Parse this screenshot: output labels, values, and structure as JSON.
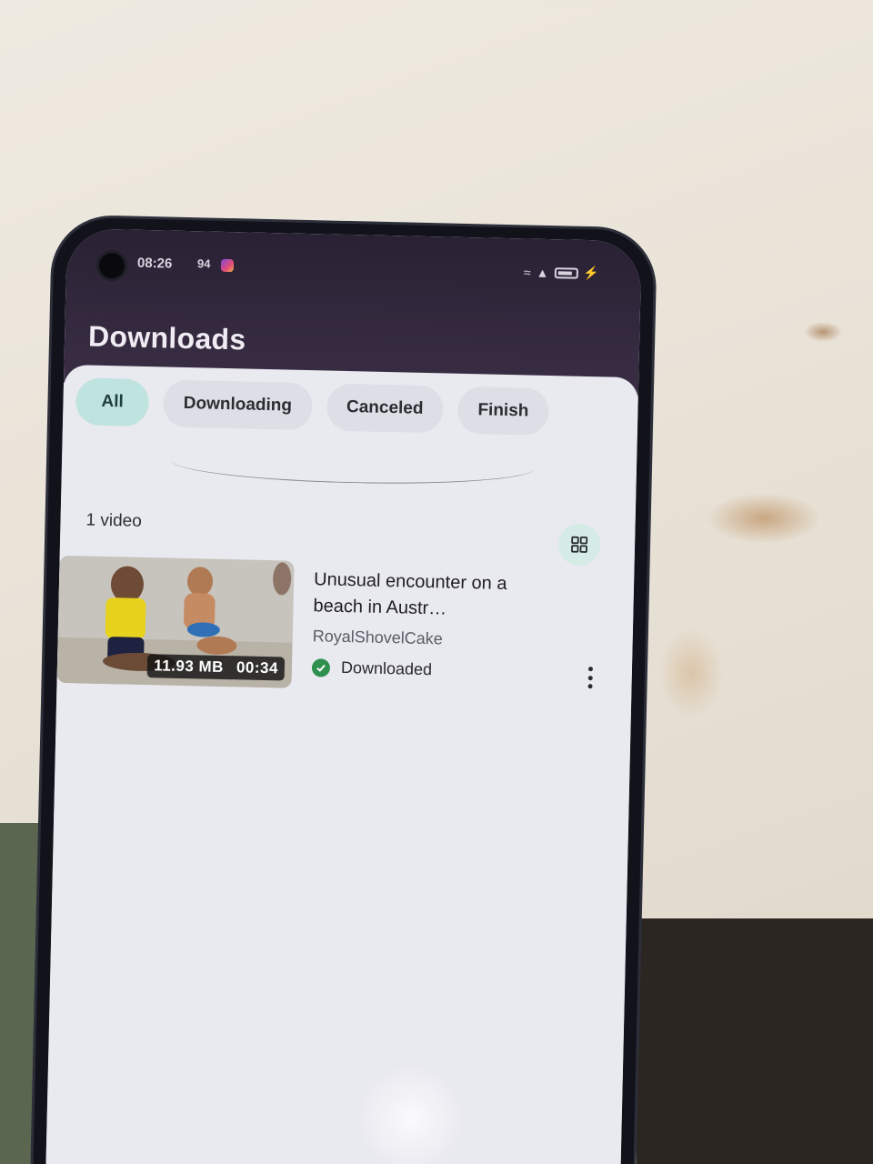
{
  "status_bar": {
    "time": "08:26",
    "network": "94",
    "icons": [
      "wifi-icon",
      "signal-icon",
      "battery-icon",
      "charging-icon"
    ]
  },
  "header": {
    "title": "Downloads"
  },
  "filters": {
    "tabs": [
      {
        "label": "All",
        "active": true
      },
      {
        "label": "Downloading",
        "active": false
      },
      {
        "label": "Canceled",
        "active": false
      },
      {
        "label": "Finish",
        "active": false
      }
    ]
  },
  "list": {
    "count_label": "1 video",
    "view_toggle_icon": "grid-view-icon",
    "items": [
      {
        "title": "Unusual encounter on a beach in Austr…",
        "channel": "RoyalShovelCake",
        "size": "11.93 MB",
        "duration": "00:34",
        "status": "Downloaded",
        "status_color": "#2f8f4e"
      }
    ]
  },
  "colors": {
    "topbar": "#2a2134",
    "active_chip": "#bfe3df",
    "chip": "#dedfe6",
    "sheet": "#e9e9f0"
  }
}
